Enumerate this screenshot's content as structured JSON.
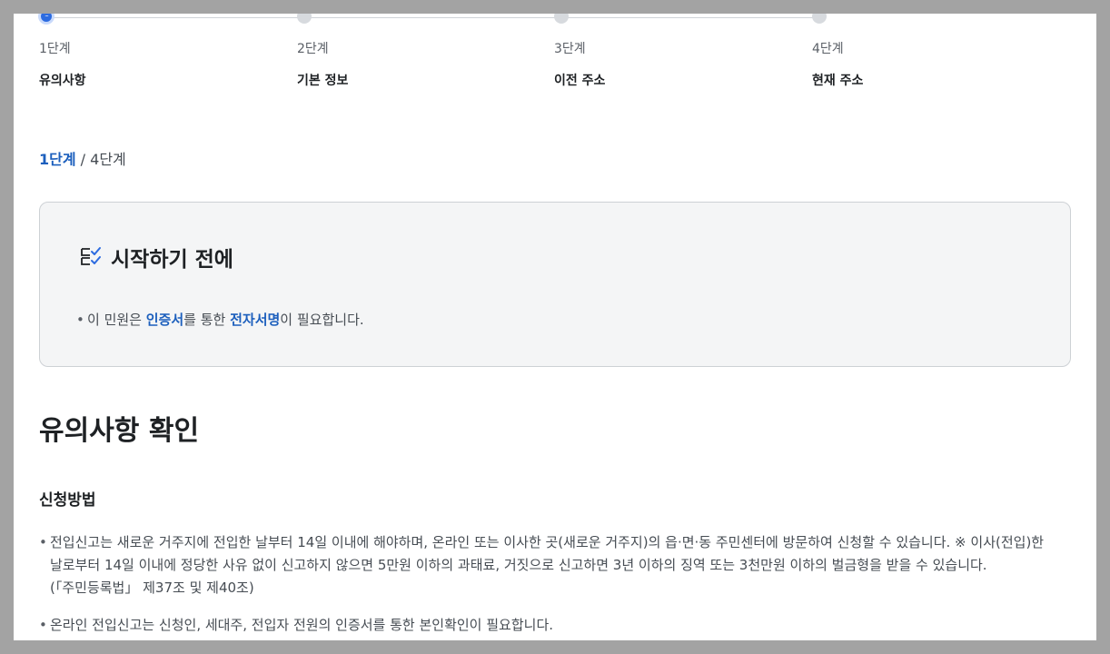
{
  "stepper": {
    "steps": [
      {
        "num": "1단계",
        "title": "유의사항",
        "active_icon": "···"
      },
      {
        "num": "2단계",
        "title": "기본 정보"
      },
      {
        "num": "3단계",
        "title": "이전 주소"
      },
      {
        "num": "4단계",
        "title": "현재 주소"
      }
    ]
  },
  "progress": {
    "current": "1단계",
    "separator": "/",
    "total": "4단계"
  },
  "info_box": {
    "icon": "checklist-icon",
    "title": "시작하기 전에",
    "line": {
      "part1": "이 민원은 ",
      "hl1": "인증서",
      "part2": "를 통한 ",
      "hl2": "전자서명",
      "part3": "이 필요합니다."
    }
  },
  "section_title": "유의사항 확인",
  "sub_title": "신청방법",
  "notices": [
    "전입신고는 새로운 거주지에 전입한 날부터 14일 이내에 해야하며, 온라인 또는 이사한 곳(새로운 거주지)의 읍·면·동 주민센터에 방문하여 신청할 수 있습니다. ※ 이사(전입)한 날로부터 14일 이내에 정당한 사유 없이 신고하지 않으면 5만원 이하의 과태료, 거짓으로 신고하면 3년 이하의 징역 또는 3천만원 이하의 벌금형을 받을 수 있습니다.(「주민등록법」 제37조 및 제40조)",
    "온라인 전입신고는 신청인, 세대주, 전입자 전원의 인증서를 통한 본인확인이 필요합니다."
  ],
  "colors": {
    "accent": "#1c5fbd",
    "active_step": "#2c6be0",
    "inactive_step": "#d7dade"
  }
}
